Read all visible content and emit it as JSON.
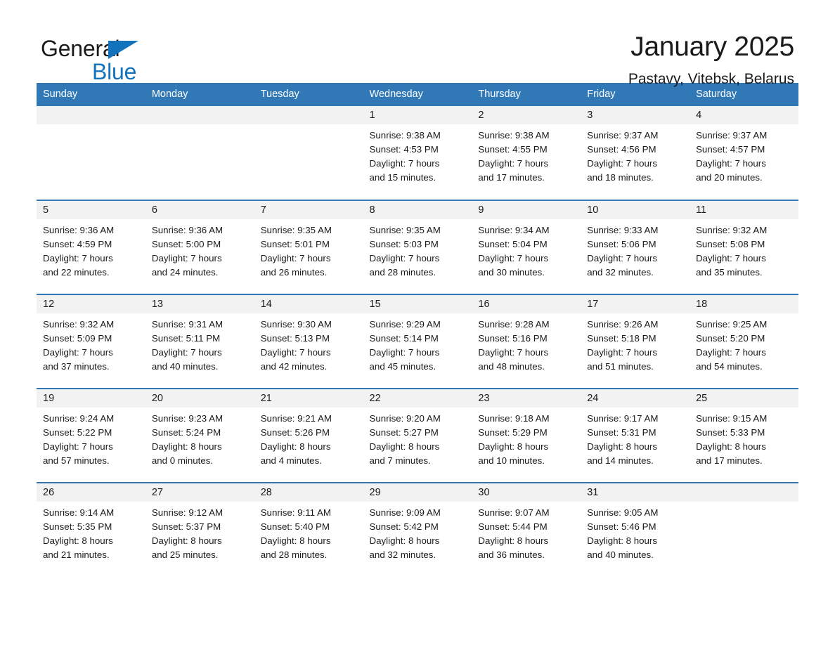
{
  "brand": {
    "name_part1": "General",
    "name_part2": "Blue",
    "logo_color": "#1273BC"
  },
  "header": {
    "title": "January 2025",
    "subtitle": "Pastavy, Vitebsk, Belarus",
    "header_bg_color": "#3178B6",
    "row_divider_color": "#3178B6",
    "day_band_color": "#f2f2f2"
  },
  "columns": [
    "Sunday",
    "Monday",
    "Tuesday",
    "Wednesday",
    "Thursday",
    "Friday",
    "Saturday"
  ],
  "weeks": [
    [
      {
        "day": "",
        "lines": []
      },
      {
        "day": "",
        "lines": []
      },
      {
        "day": "",
        "lines": []
      },
      {
        "day": "1",
        "lines": [
          "Sunrise: 9:38 AM",
          "Sunset: 4:53 PM",
          "Daylight: 7 hours",
          "and 15 minutes."
        ]
      },
      {
        "day": "2",
        "lines": [
          "Sunrise: 9:38 AM",
          "Sunset: 4:55 PM",
          "Daylight: 7 hours",
          "and 17 minutes."
        ]
      },
      {
        "day": "3",
        "lines": [
          "Sunrise: 9:37 AM",
          "Sunset: 4:56 PM",
          "Daylight: 7 hours",
          "and 18 minutes."
        ]
      },
      {
        "day": "4",
        "lines": [
          "Sunrise: 9:37 AM",
          "Sunset: 4:57 PM",
          "Daylight: 7 hours",
          "and 20 minutes."
        ]
      }
    ],
    [
      {
        "day": "5",
        "lines": [
          "Sunrise: 9:36 AM",
          "Sunset: 4:59 PM",
          "Daylight: 7 hours",
          "and 22 minutes."
        ]
      },
      {
        "day": "6",
        "lines": [
          "Sunrise: 9:36 AM",
          "Sunset: 5:00 PM",
          "Daylight: 7 hours",
          "and 24 minutes."
        ]
      },
      {
        "day": "7",
        "lines": [
          "Sunrise: 9:35 AM",
          "Sunset: 5:01 PM",
          "Daylight: 7 hours",
          "and 26 minutes."
        ]
      },
      {
        "day": "8",
        "lines": [
          "Sunrise: 9:35 AM",
          "Sunset: 5:03 PM",
          "Daylight: 7 hours",
          "and 28 minutes."
        ]
      },
      {
        "day": "9",
        "lines": [
          "Sunrise: 9:34 AM",
          "Sunset: 5:04 PM",
          "Daylight: 7 hours",
          "and 30 minutes."
        ]
      },
      {
        "day": "10",
        "lines": [
          "Sunrise: 9:33 AM",
          "Sunset: 5:06 PM",
          "Daylight: 7 hours",
          "and 32 minutes."
        ]
      },
      {
        "day": "11",
        "lines": [
          "Sunrise: 9:32 AM",
          "Sunset: 5:08 PM",
          "Daylight: 7 hours",
          "and 35 minutes."
        ]
      }
    ],
    [
      {
        "day": "12",
        "lines": [
          "Sunrise: 9:32 AM",
          "Sunset: 5:09 PM",
          "Daylight: 7 hours",
          "and 37 minutes."
        ]
      },
      {
        "day": "13",
        "lines": [
          "Sunrise: 9:31 AM",
          "Sunset: 5:11 PM",
          "Daylight: 7 hours",
          "and 40 minutes."
        ]
      },
      {
        "day": "14",
        "lines": [
          "Sunrise: 9:30 AM",
          "Sunset: 5:13 PM",
          "Daylight: 7 hours",
          "and 42 minutes."
        ]
      },
      {
        "day": "15",
        "lines": [
          "Sunrise: 9:29 AM",
          "Sunset: 5:14 PM",
          "Daylight: 7 hours",
          "and 45 minutes."
        ]
      },
      {
        "day": "16",
        "lines": [
          "Sunrise: 9:28 AM",
          "Sunset: 5:16 PM",
          "Daylight: 7 hours",
          "and 48 minutes."
        ]
      },
      {
        "day": "17",
        "lines": [
          "Sunrise: 9:26 AM",
          "Sunset: 5:18 PM",
          "Daylight: 7 hours",
          "and 51 minutes."
        ]
      },
      {
        "day": "18",
        "lines": [
          "Sunrise: 9:25 AM",
          "Sunset: 5:20 PM",
          "Daylight: 7 hours",
          "and 54 minutes."
        ]
      }
    ],
    [
      {
        "day": "19",
        "lines": [
          "Sunrise: 9:24 AM",
          "Sunset: 5:22 PM",
          "Daylight: 7 hours",
          "and 57 minutes."
        ]
      },
      {
        "day": "20",
        "lines": [
          "Sunrise: 9:23 AM",
          "Sunset: 5:24 PM",
          "Daylight: 8 hours",
          "and 0 minutes."
        ]
      },
      {
        "day": "21",
        "lines": [
          "Sunrise: 9:21 AM",
          "Sunset: 5:26 PM",
          "Daylight: 8 hours",
          "and 4 minutes."
        ]
      },
      {
        "day": "22",
        "lines": [
          "Sunrise: 9:20 AM",
          "Sunset: 5:27 PM",
          "Daylight: 8 hours",
          "and 7 minutes."
        ]
      },
      {
        "day": "23",
        "lines": [
          "Sunrise: 9:18 AM",
          "Sunset: 5:29 PM",
          "Daylight: 8 hours",
          "and 10 minutes."
        ]
      },
      {
        "day": "24",
        "lines": [
          "Sunrise: 9:17 AM",
          "Sunset: 5:31 PM",
          "Daylight: 8 hours",
          "and 14 minutes."
        ]
      },
      {
        "day": "25",
        "lines": [
          "Sunrise: 9:15 AM",
          "Sunset: 5:33 PM",
          "Daylight: 8 hours",
          "and 17 minutes."
        ]
      }
    ],
    [
      {
        "day": "26",
        "lines": [
          "Sunrise: 9:14 AM",
          "Sunset: 5:35 PM",
          "Daylight: 8 hours",
          "and 21 minutes."
        ]
      },
      {
        "day": "27",
        "lines": [
          "Sunrise: 9:12 AM",
          "Sunset: 5:37 PM",
          "Daylight: 8 hours",
          "and 25 minutes."
        ]
      },
      {
        "day": "28",
        "lines": [
          "Sunrise: 9:11 AM",
          "Sunset: 5:40 PM",
          "Daylight: 8 hours",
          "and 28 minutes."
        ]
      },
      {
        "day": "29",
        "lines": [
          "Sunrise: 9:09 AM",
          "Sunset: 5:42 PM",
          "Daylight: 8 hours",
          "and 32 minutes."
        ]
      },
      {
        "day": "30",
        "lines": [
          "Sunrise: 9:07 AM",
          "Sunset: 5:44 PM",
          "Daylight: 8 hours",
          "and 36 minutes."
        ]
      },
      {
        "day": "31",
        "lines": [
          "Sunrise: 9:05 AM",
          "Sunset: 5:46 PM",
          "Daylight: 8 hours",
          "and 40 minutes."
        ]
      },
      {
        "day": "",
        "lines": []
      }
    ]
  ]
}
